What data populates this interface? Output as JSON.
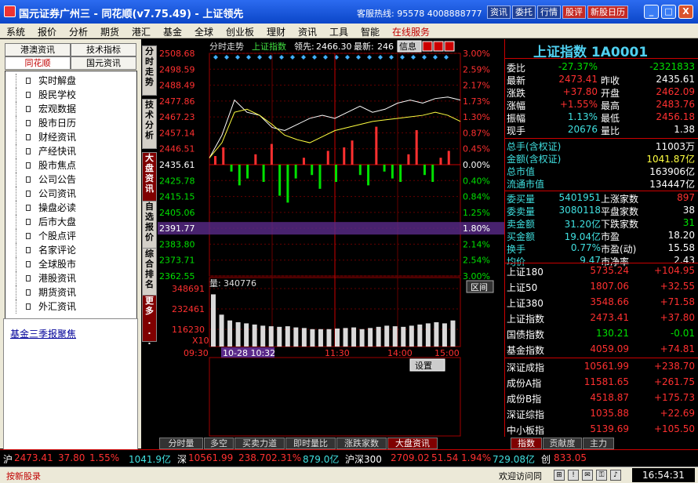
{
  "titlebar": {
    "title": "国元证券广州三 - 同花顺(v7.75.49) - 上证领先",
    "hotline": "客服热线: 95578 4008888777",
    "buttons": [
      "资讯",
      "委托",
      "行情",
      "股评",
      "新股日历"
    ],
    "minimize": "_",
    "maximize": "□",
    "close": "X"
  },
  "menu": [
    "系统",
    "报价",
    "分析",
    "期货",
    "港汇",
    "基金",
    "全球",
    "创业板",
    "理财",
    "资讯",
    "工具",
    "智能",
    "在线服务"
  ],
  "left": {
    "tabs_row1": [
      "港澳资讯",
      "技术指标"
    ],
    "tabs_row2": [
      "同花顺",
      "国元资讯"
    ],
    "items": [
      "实时解盘",
      "股民学校",
      "宏观数据",
      "股市日历",
      "财经资讯",
      "产经快讯",
      "股市焦点",
      "公司公告",
      "公司资讯",
      "操盘必读",
      "后市大盘",
      "个股点评",
      "名家评论",
      "全球股市",
      "港股资讯",
      "期货资讯",
      "外汇资讯"
    ],
    "fund_link": "基金三季报聚焦"
  },
  "vtabs": [
    "分时走势",
    "技术分析",
    "大盘资讯",
    "自选报价",
    "综合排名",
    "更多..."
  ],
  "chart": {
    "header_title": "分时走势",
    "index_name": "上证指数",
    "lead_label": "领先:",
    "lead_value": "2466.30",
    "latest_label": "最新:",
    "latest_value": "246",
    "info_btn": "信息",
    "volume_label": "量:",
    "volume_value": "340776",
    "x10": "X10",
    "interval_btn": "区间",
    "settings_btn": "设置",
    "cursor_time": "10-28 10:32",
    "cursor_price": "2391.77",
    "cursor_pct": "1.80%",
    "price_ticks": [
      "2508.68",
      "2498.59",
      "2488.49",
      "2477.86",
      "2467.23",
      "2457.14",
      "2446.51",
      "2435.61",
      "2425.78",
      "2415.15",
      "2405.06",
      "2391.77",
      "2383.80",
      "2373.71",
      "2362.55"
    ],
    "pct_ticks": [
      "3.00%",
      "2.59%",
      "2.17%",
      "1.73%",
      "1.30%",
      "0.87%",
      "0.45%",
      "0.00%",
      "0.40%",
      "0.84%",
      "1.25%",
      "1.80%",
      "2.14%",
      "2.54%",
      "3.00%"
    ],
    "vol_ticks": [
      "348691",
      "232461",
      "116230"
    ],
    "time_ticks": [
      "09:30",
      "11:30",
      "14:00",
      "15:00"
    ]
  },
  "chart_data": {
    "type": "line",
    "title": "",
    "series": [
      {
        "name": "",
        "values": [
          2440,
          2455,
          2478,
          2470,
          2468,
          2460,
          2458,
          2462,
          2466,
          2468,
          2466,
          2470,
          2474,
          2470,
          2472,
          2476,
          2478,
          2476,
          2479,
          2480,
          2478
        ]
      },
      {
        "name": "",
        "values": [
          2440,
          2450,
          2470,
          2472,
          2468,
          2462,
          2455,
          2452,
          2450,
          2454,
          2458,
          2460,
          2462,
          2464,
          2465,
          2466,
          2467,
          2468,
          2470,
          2468,
          2464
        ]
      }
    ],
    "volume": [
      0.9,
      0.55,
      0.45,
      0.42,
      0.4,
      0.38,
      0.36,
      0.35,
      0.34,
      0.35,
      0.33,
      0.32,
      0.3,
      0.3,
      0.3,
      0.31,
      0.32,
      0.33,
      0.3,
      0.32,
      0.34,
      0.36,
      0.35,
      0.34,
      0.36,
      0.38,
      0.4,
      0.42,
      0.4,
      0.45
    ],
    "net_bars": [
      5,
      10,
      -4,
      -12,
      -8,
      6,
      -10,
      12,
      -18,
      -22,
      -8,
      4,
      -6,
      -14,
      8,
      -10,
      10,
      14,
      -6,
      -12,
      22,
      -4,
      -8,
      -10,
      6,
      20,
      -6,
      -10,
      4,
      8
    ],
    "ylim": [
      2362.55,
      2508.68
    ]
  },
  "right": {
    "title": "上证指数 1A0001",
    "rows": [
      {
        "l": "委比",
        "v": "-27.37%",
        "v2": "-2321833"
      },
      {
        "l": "最新",
        "v": "2473.41",
        "l2": "昨收",
        "v2": "2435.61"
      },
      {
        "l": "涨跌",
        "v": "+37.80",
        "l2": "开盘",
        "v2": "2462.09"
      },
      {
        "l": "涨幅",
        "v": "+1.55%",
        "l2": "最高",
        "v2": "2483.76"
      },
      {
        "l": "振幅",
        "v": "1.13%",
        "l2": "最低",
        "v2": "2456.18"
      },
      {
        "l": "现手",
        "v": "20676",
        "l2": "量比",
        "v2": "1.38"
      }
    ],
    "rows2": [
      {
        "l": "总手(含权证)",
        "v": "11003万"
      },
      {
        "l": "金额(含权证)",
        "v": "1041.87亿"
      },
      {
        "l": "总市值",
        "v": "163906亿"
      },
      {
        "l": "流通市值",
        "v": "134447亿"
      }
    ],
    "rows3": [
      {
        "l": "委买量",
        "v": "5401951",
        "l2": "上涨家数",
        "v2": "897"
      },
      {
        "l": "委卖量",
        "v": "3080118",
        "l2": "平盘家数",
        "v2": "38"
      },
      {
        "l": "卖金额",
        "v": "31.20亿",
        "l2": "下跌家数",
        "v2": "31"
      },
      {
        "l": "买金额",
        "v": "19.04亿",
        "l2": "市盈",
        "v2": "18.20"
      },
      {
        "l": "换手",
        "v": "0.77%",
        "l2": "市盈(动)",
        "v2": "15.58"
      },
      {
        "l": "均价",
        "v": "9.47",
        "l2": "市净率",
        "v2": "2.43"
      }
    ],
    "indices": [
      {
        "n": "上证180",
        "v": "5735.24",
        "c": "+104.95"
      },
      {
        "n": "上证50",
        "v": "1807.06",
        "c": "+32.55"
      },
      {
        "n": "上证380",
        "v": "3548.66",
        "c": "+71.58"
      },
      {
        "n": "上证指数",
        "v": "2473.41",
        "c": "+37.80"
      },
      {
        "n": "国债指数",
        "v": "130.21",
        "c": "-0.01"
      },
      {
        "n": "基金指数",
        "v": "4059.09",
        "c": "+74.81"
      },
      {
        "n": "深证成指",
        "v": "10561.99",
        "c": "+238.70"
      },
      {
        "n": "成份A指",
        "v": "11581.65",
        "c": "+261.75"
      },
      {
        "n": "成份B指",
        "v": "4518.87",
        "c": "+175.73"
      },
      {
        "n": "深证综指",
        "v": "1035.88",
        "c": "+22.69"
      },
      {
        "n": "中小板指",
        "v": "5139.69",
        "c": "+105.50"
      }
    ],
    "tabs": [
      "指数",
      "贡献度",
      "主力"
    ]
  },
  "bottom_tabs": [
    "分时量",
    "多空",
    "买卖力道",
    "即时量比",
    "涨跌家数",
    "大盘资讯"
  ],
  "ticker": {
    "sh_label": "沪",
    "sh": "2473.41",
    "sh_chg": "37.80",
    "sh_pct": "1.55%",
    "sh_amt": "1041.9亿",
    "sz_label": "深",
    "sz": "10561.99",
    "sz_chg": "238.70",
    "sz_pct": "2.31%",
    "sz_amt": "879.0亿",
    "hs_label": "沪深300",
    "hs": "2709.02",
    "hs_chg": "51.54",
    "hs_pct": "1.94%",
    "hs_amt": "729.08亿",
    "cy_label": "创",
    "cy": "833.05"
  },
  "status": {
    "hint": "按新股录",
    "welcome": "欢迎访问同",
    "clock": "16:54:31"
  },
  "colors": {
    "up": "#ff3030",
    "down": "#00e000",
    "accent": "#4fd0f0",
    "titlebar": "#0b46c8"
  }
}
